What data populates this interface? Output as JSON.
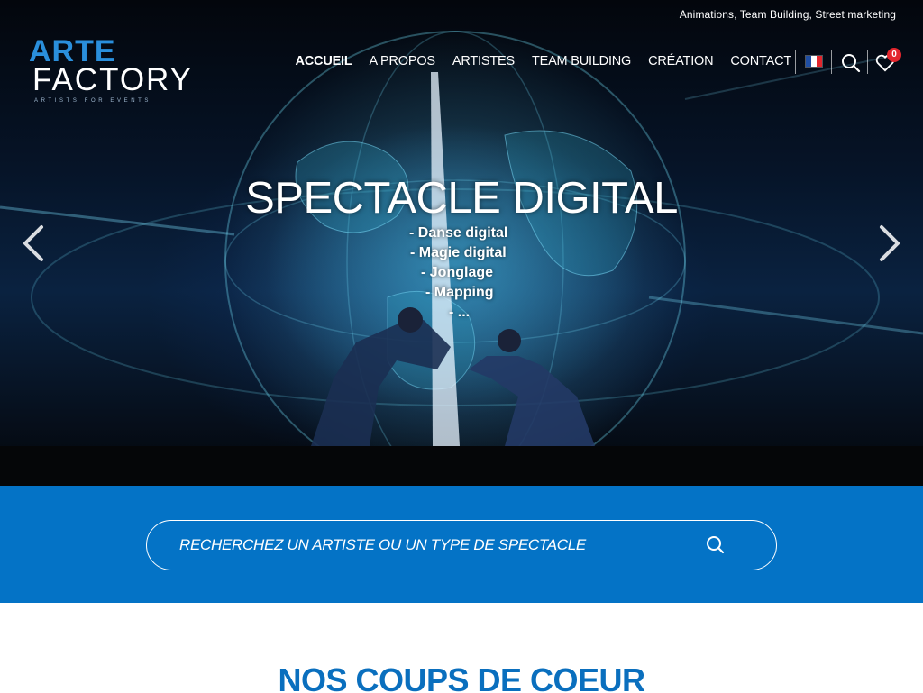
{
  "topbar": {
    "tagline": "Animations, Team Building, Street marketing"
  },
  "logo": {
    "line1": "ARTE",
    "line2": "FACTORY",
    "subtitle": "ARTISTS FOR EVENTS"
  },
  "nav": {
    "items": [
      {
        "label": "ACCUEIL",
        "active": true
      },
      {
        "label": "A PROPOS"
      },
      {
        "label": "ARTISTES"
      },
      {
        "label": "TEAM BUILDING"
      },
      {
        "label": "CRÉATION"
      },
      {
        "label": "CONTACT"
      }
    ],
    "cart_count": "0"
  },
  "hero": {
    "title": "SPECTACLE DIGITAL",
    "list": [
      "- Danse digital",
      "- Magie digital",
      "- Jonglage",
      "- Mapping",
      "- ..."
    ]
  },
  "search": {
    "placeholder": "RECHERCHEZ UN ARTISTE OU UN TYPE DE SPECTACLE"
  },
  "section": {
    "title": "NOS COUPS DE COEUR"
  },
  "colors": {
    "brand_blue": "#0473c6",
    "title_blue": "#0a6fbe",
    "badge_red": "#e3262d"
  }
}
